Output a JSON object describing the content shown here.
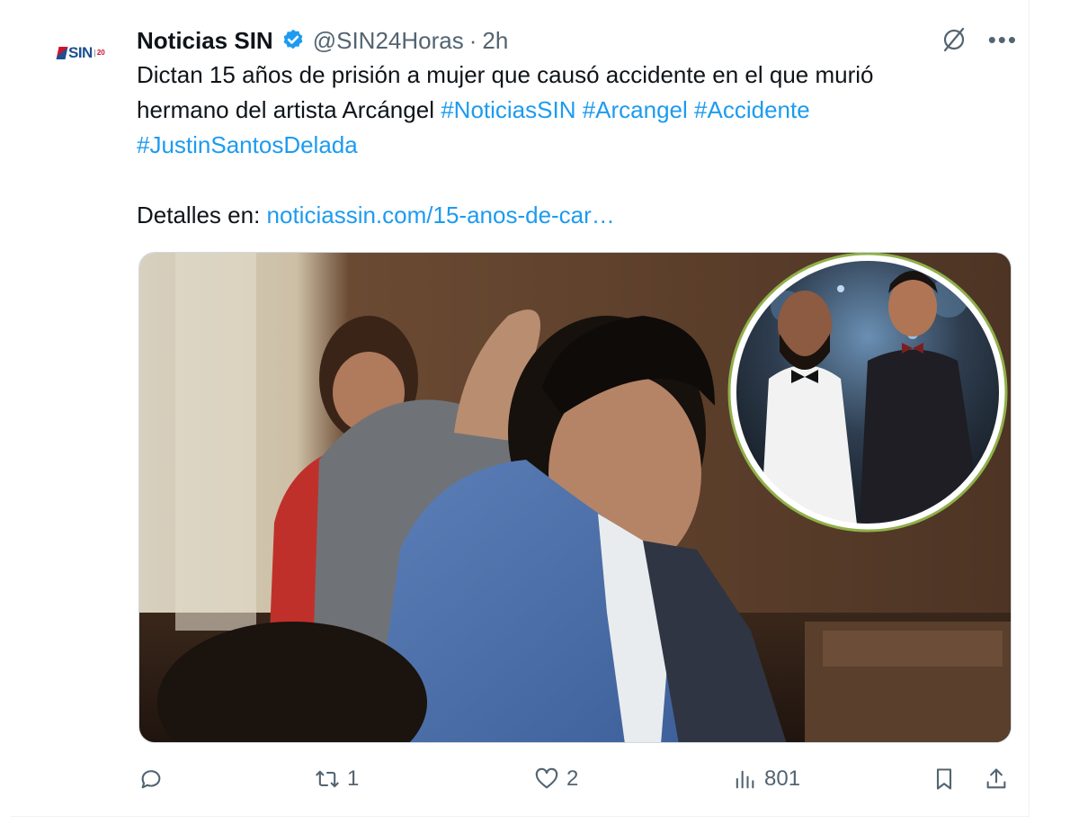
{
  "account": {
    "logo_text": "SIN",
    "logo_sub": "20",
    "name": "Noticias SIN",
    "handle": "@SIN24Horas",
    "separator": "·",
    "time": "2h"
  },
  "tweet": {
    "line1": "Dictan 15 años de prisión a mujer que causó accidente en el que murió",
    "line2_text": "hermano del artista Arcángel ",
    "hashtags": [
      "#NoticiasSIN",
      "#Arcangel",
      "#Accidente",
      "#JustinSantosDelada"
    ],
    "details_label": "Detalles en: ",
    "link": "noticiassin.com/15-anos-de-car…"
  },
  "actions": {
    "reply_count": "",
    "retweet_count": "1",
    "like_count": "2",
    "views_count": "801"
  },
  "colors": {
    "accent": "#1d9bf0",
    "secondary_text": "#536471",
    "verified": "#1d9bf0"
  }
}
